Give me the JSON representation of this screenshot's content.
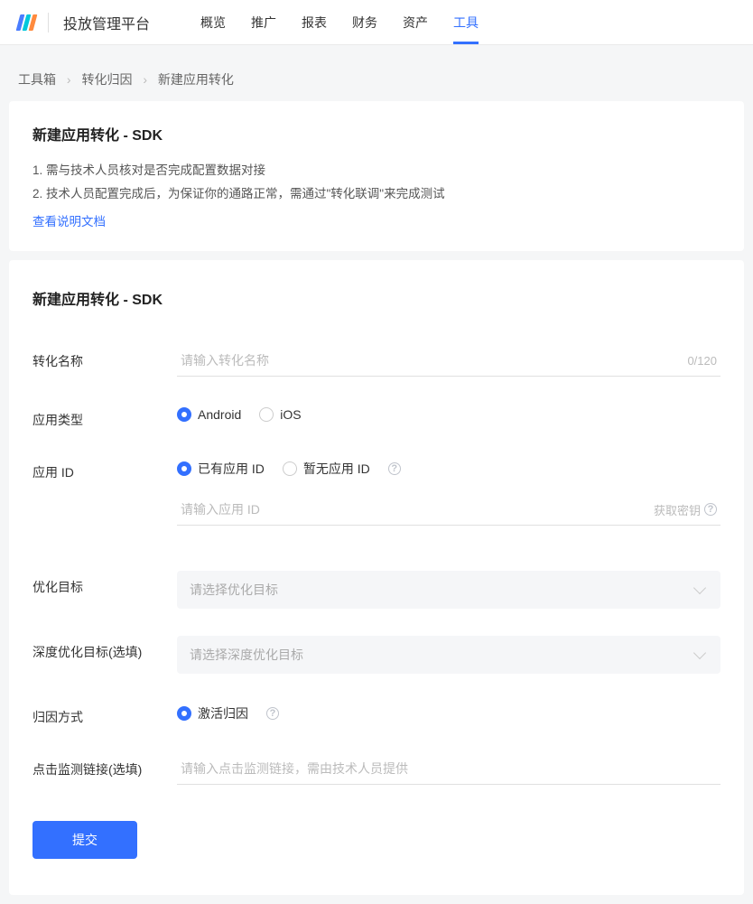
{
  "header": {
    "platform_name": "投放管理平台",
    "nav": [
      {
        "label": "概览",
        "active": false
      },
      {
        "label": "推广",
        "active": false
      },
      {
        "label": "报表",
        "active": false
      },
      {
        "label": "财务",
        "active": false
      },
      {
        "label": "资产",
        "active": false
      },
      {
        "label": "工具",
        "active": true
      }
    ]
  },
  "breadcrumb": {
    "items": [
      "工具箱",
      "转化归因",
      "新建应用转化"
    ],
    "sep": "›"
  },
  "intro": {
    "title": "新建应用转化 - SDK",
    "lines": [
      "1. 需与技术人员核对是否完成配置数据对接",
      "2. 技术人员配置完成后，为保证你的通路正常，需通过\"转化联调\"来完成测试"
    ],
    "doc_link": "查看说明文档"
  },
  "form": {
    "title": "新建应用转化 - SDK",
    "name_label": "转化名称",
    "name_placeholder": "请输入转化名称",
    "name_count": "0/120",
    "app_type_label": "应用类型",
    "app_type_options": {
      "android": "Android",
      "ios": "iOS"
    },
    "app_id_label": "应用 ID",
    "app_id_options": {
      "has": "已有应用 ID",
      "none": "暂无应用 ID"
    },
    "app_id_placeholder": "请输入应用 ID",
    "get_key_label": "获取密钥",
    "opt_goal_label": "优化目标",
    "opt_goal_placeholder": "请选择优化目标",
    "deep_opt_label": "深度优化目标(选填)",
    "deep_opt_placeholder": "请选择深度优化目标",
    "attribution_label": "归因方式",
    "attribution_option": "激活归因",
    "click_monitor_label": "点击监测链接(选填)",
    "click_monitor_placeholder": "请输入点击监测链接，需由技术人员提供",
    "submit_label": "提交"
  },
  "colors": {
    "primary": "#3370ff",
    "logo_blue": "#4a7dff",
    "logo_cyan": "#00c8dc",
    "logo_orange": "#ff8a3d"
  }
}
